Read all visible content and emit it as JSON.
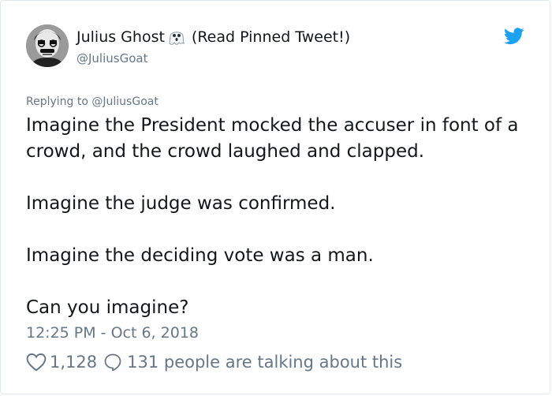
{
  "author": {
    "display_name": "Julius Ghost",
    "emoji": "ghost-emoji-icon",
    "pinned_note": "(Read Pinned Tweet!)",
    "handle": "@JuliusGoat"
  },
  "reply": {
    "prefix": "Replying to",
    "target": "@JuliusGoat"
  },
  "tweet": {
    "paragraphs": [
      "Imagine the President mocked the accuser in font of a crowd, and the crowd laughed and clapped.",
      "Imagine the judge was confirmed.",
      "Imagine the deciding vote was a man.",
      "Can you imagine?"
    ],
    "timestamp": "12:25 PM - Oct 6, 2018"
  },
  "engagement": {
    "likes": "1,128",
    "talking": "131 people are talking about this"
  },
  "colors": {
    "twitter_blue": "#1da1f2",
    "muted": "#657786",
    "text": "#14171a"
  }
}
